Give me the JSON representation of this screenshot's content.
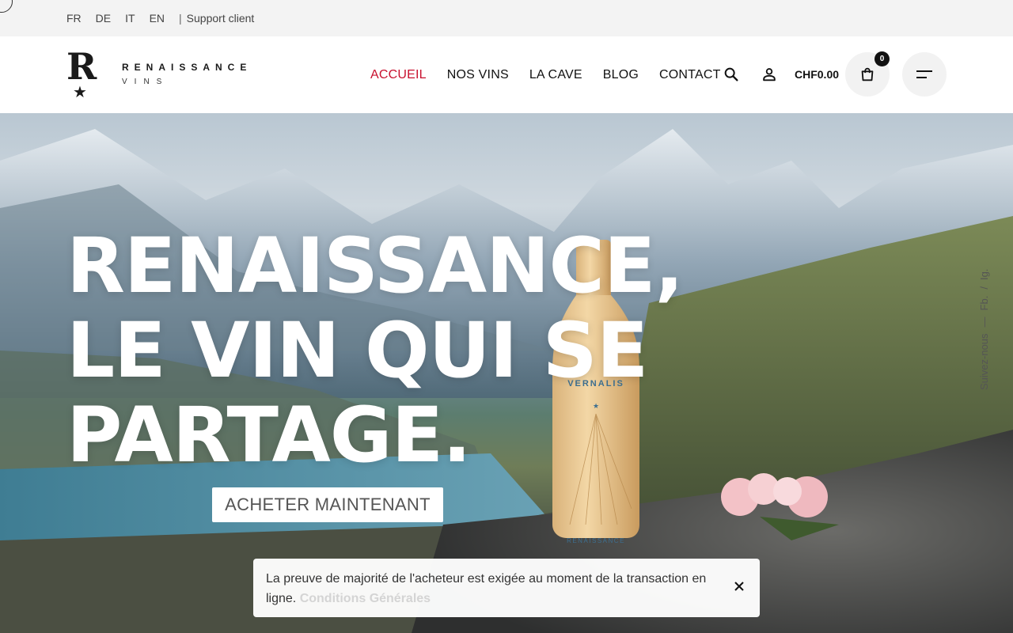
{
  "topbar": {
    "languages": [
      "FR",
      "DE",
      "IT",
      "EN"
    ],
    "separator": "|",
    "support": "Support client"
  },
  "logo": {
    "letter": "R",
    "name": "RENAISSANCE",
    "sub": "VINS"
  },
  "nav": {
    "items": [
      "ACCUEIL",
      "NOS VINS",
      "LA CAVE",
      "BLOG",
      "CONTACT"
    ],
    "active": "ACCUEIL",
    "active_color": "#c8102e"
  },
  "header": {
    "cart_total": "CHF0.00",
    "cart_count": "0",
    "icons": [
      "search-icon",
      "user-icon",
      "shopping-bag-icon",
      "menu-icon"
    ]
  },
  "hero": {
    "title_lines": [
      "RENAISSANCE,",
      "LE VIN QUI SE",
      "PARTAGE."
    ],
    "cta": "ACHETER MAINTENANT",
    "bottle_label": "VERNALIS",
    "bottle_brand": "RENAISSANCE"
  },
  "social": {
    "label": "Suivez-nous",
    "dash": "—",
    "links": [
      "Fb.",
      "/",
      "Ig."
    ]
  },
  "notice": {
    "text": "La preuve de majorité de l'acheteur est exigée au moment de la transaction en ligne.",
    "link": "Conditions Générales"
  }
}
